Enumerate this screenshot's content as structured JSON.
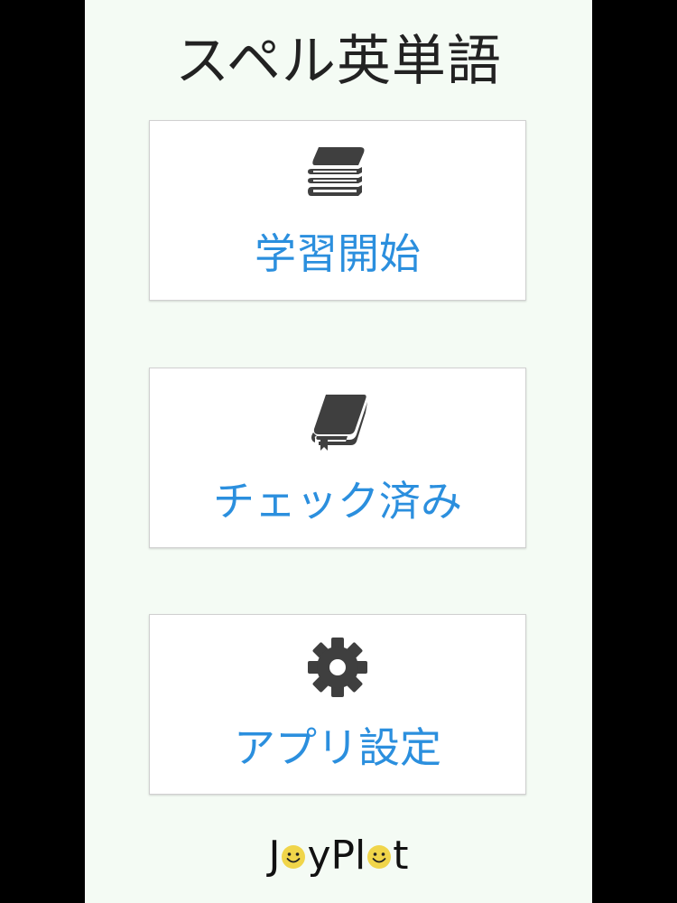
{
  "app": {
    "title": "スペル英単語"
  },
  "menu": {
    "items": [
      {
        "label": "学習開始",
        "icon": "books-stack-icon"
      },
      {
        "label": "チェック済み",
        "icon": "bookmarked-book-icon"
      },
      {
        "label": "アプリ設定",
        "icon": "gear-icon"
      }
    ]
  },
  "brand": {
    "part1": "J",
    "part2": "yPl",
    "part3": "t"
  },
  "colors": {
    "background": "#f4fbf4",
    "accent_text": "#2b8fde",
    "icon": "#3f3f3f",
    "smiley": "#f0d54a"
  }
}
